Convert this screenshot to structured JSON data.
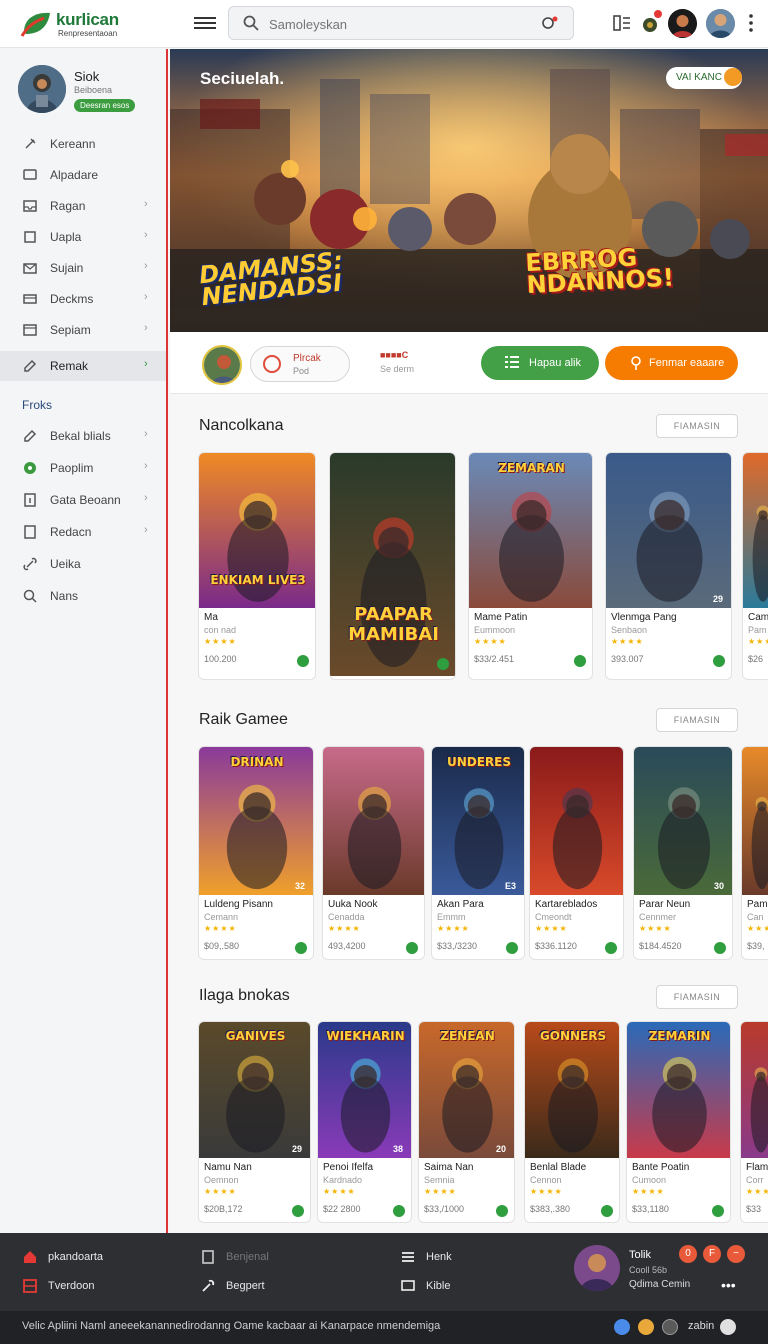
{
  "header": {
    "logo_title": "kurlican",
    "logo_sub": "Renpresentaoan",
    "search_placeholder": "Samoleyskan",
    "brand_color": "#1f7a3a"
  },
  "sidebar": {
    "profile": {
      "name": "Siok",
      "sub": "Beiboena",
      "badge": "Deesran esos"
    },
    "items": [
      {
        "label": "Kereann",
        "icon": "pin-icon",
        "chevron": false
      },
      {
        "label": "Alpadare",
        "icon": "chat-icon",
        "chevron": false
      },
      {
        "label": "Ragan",
        "icon": "inbox-icon",
        "chevron": true
      },
      {
        "label": "Uapla",
        "icon": "square-icon",
        "chevron": true
      },
      {
        "label": "Sujain",
        "icon": "mail-icon",
        "chevron": true
      },
      {
        "label": "Deckms",
        "icon": "card-icon",
        "chevron": true
      },
      {
        "label": "Sepiam",
        "icon": "window-icon",
        "chevron": true
      },
      {
        "label": "Remak",
        "icon": "pencil-icon",
        "chevron": true,
        "active": true
      }
    ],
    "section_label": "Froks",
    "section_items": [
      {
        "label": "Bekal blials",
        "icon": "pencil-icon",
        "chevron": true
      },
      {
        "label": "Paoplim",
        "icon": "green-dot-icon",
        "chevron": true
      },
      {
        "label": "Gata Beoann",
        "icon": "info-icon",
        "chevron": true
      },
      {
        "label": "Redacn",
        "icon": "doc-icon",
        "chevron": true
      },
      {
        "label": "Ueika",
        "icon": "link-icon",
        "chevron": false
      },
      {
        "label": "Nans",
        "icon": "search-icon",
        "chevron": false
      }
    ]
  },
  "hero": {
    "title": "Seciuelah.",
    "chip_label": "VAI KANC",
    "logo_left": "DAMANSS: NENDADSI",
    "logo_right": "EBRROG NDANNOS!"
  },
  "actionbar": {
    "play_title": "Plrcak",
    "play_sub": "Pod",
    "stat_title": "■■■■C",
    "stat_sub": "Se derm",
    "green_button": "Hapau alik",
    "orange_button": "Fenmar eaaare"
  },
  "sections": [
    {
      "title": "Nancolkana",
      "see_all": "FIAMASIN",
      "cards": [
        {
          "title": "Ma",
          "sub": "con nad",
          "price": "100.200",
          "art_text": "ENKIAM LIVE3",
          "num": ""
        },
        {
          "title": "",
          "sub": "",
          "price": "",
          "art_text": "PAAPAR MAMIBAI",
          "num": ""
        },
        {
          "title": "Mame Patin",
          "sub": "Eummoon",
          "price": "$33/2.451",
          "art_text": "ZEMARAN",
          "num": ""
        },
        {
          "title": "Vlenmga Pang",
          "sub": "Senbaon",
          "price": "393.007",
          "art_text": "",
          "num": "29"
        },
        {
          "title": "Cam",
          "sub": "Pam",
          "price": "$26",
          "art_text": "",
          "num": ""
        }
      ]
    },
    {
      "title": "Raik Gamee",
      "see_all": "FIAMASIN",
      "cards": [
        {
          "title": "Luldeng Pisann",
          "sub": "Cemann",
          "price": "$09,.580",
          "art_text": "DRINAN",
          "num": "32"
        },
        {
          "title": "Uuka Nook",
          "sub": "Cenadda",
          "price": "493,4200",
          "art_text": "",
          "num": ""
        },
        {
          "title": "Akan Para",
          "sub": "Emmm",
          "price": "$33,/3230",
          "art_text": "UNDERES",
          "num": "E3"
        },
        {
          "title": "Kartareblados",
          "sub": "Cmeondt",
          "price": "$336.1120",
          "art_text": "",
          "num": ""
        },
        {
          "title": "Parar Neun",
          "sub": "Cennmer",
          "price": "$184.4520",
          "art_text": "",
          "num": "30"
        },
        {
          "title": "Pam",
          "sub": "Can",
          "price": "$39,",
          "art_text": "",
          "num": ""
        }
      ]
    },
    {
      "title": "Ilaga bnokas",
      "see_all": "FIAMASIN",
      "cards": [
        {
          "title": "Namu Nan",
          "sub": "Oemnon",
          "price": "$20B,172",
          "art_text": "GANIVES",
          "num": "29"
        },
        {
          "title": "Penoi Ifelfa",
          "sub": "Kardnado",
          "price": "$22 2800",
          "art_text": "WIEKHARIN",
          "num": "38"
        },
        {
          "title": "Saima Nan",
          "sub": "Semnia",
          "price": "$33,/1000",
          "art_text": "ZENEAN",
          "num": "20"
        },
        {
          "title": "Benlal Blade",
          "sub": "Cennon",
          "price": "$383,.380",
          "art_text": "GONNERS",
          "num": ""
        },
        {
          "title": "Bante Poatin",
          "sub": "Cumoon",
          "price": "$33,1180",
          "art_text": "ZEMARIN",
          "num": ""
        },
        {
          "title": "Flam",
          "sub": "Corr",
          "price": "$33",
          "art_text": "",
          "num": ""
        }
      ]
    }
  ],
  "bottombar": {
    "left": [
      {
        "label": "pkandoarta",
        "icon": "home-icon"
      },
      {
        "label": "Tverdoon",
        "icon": "box-icon"
      }
    ],
    "mid": [
      {
        "label": "Benjenal",
        "icon": "book-icon"
      },
      {
        "label": "Begpert",
        "icon": "tool-icon"
      }
    ],
    "right": [
      {
        "label": "Henk",
        "icon": "list-icon"
      },
      {
        "label": "Kible",
        "icon": "chat-icon"
      }
    ],
    "user": {
      "name": "Tolik",
      "sub1": "Cooll 56b",
      "sub2": "Qdima Cemin"
    },
    "circles": [
      "0",
      "F",
      "−"
    ],
    "more": "•••"
  },
  "footer": {
    "text": "Velic Apliini Naml aneeekanannedirodanng Oame kacbaar ai Kanarpace nmendemiga",
    "right_label": "zabin"
  }
}
